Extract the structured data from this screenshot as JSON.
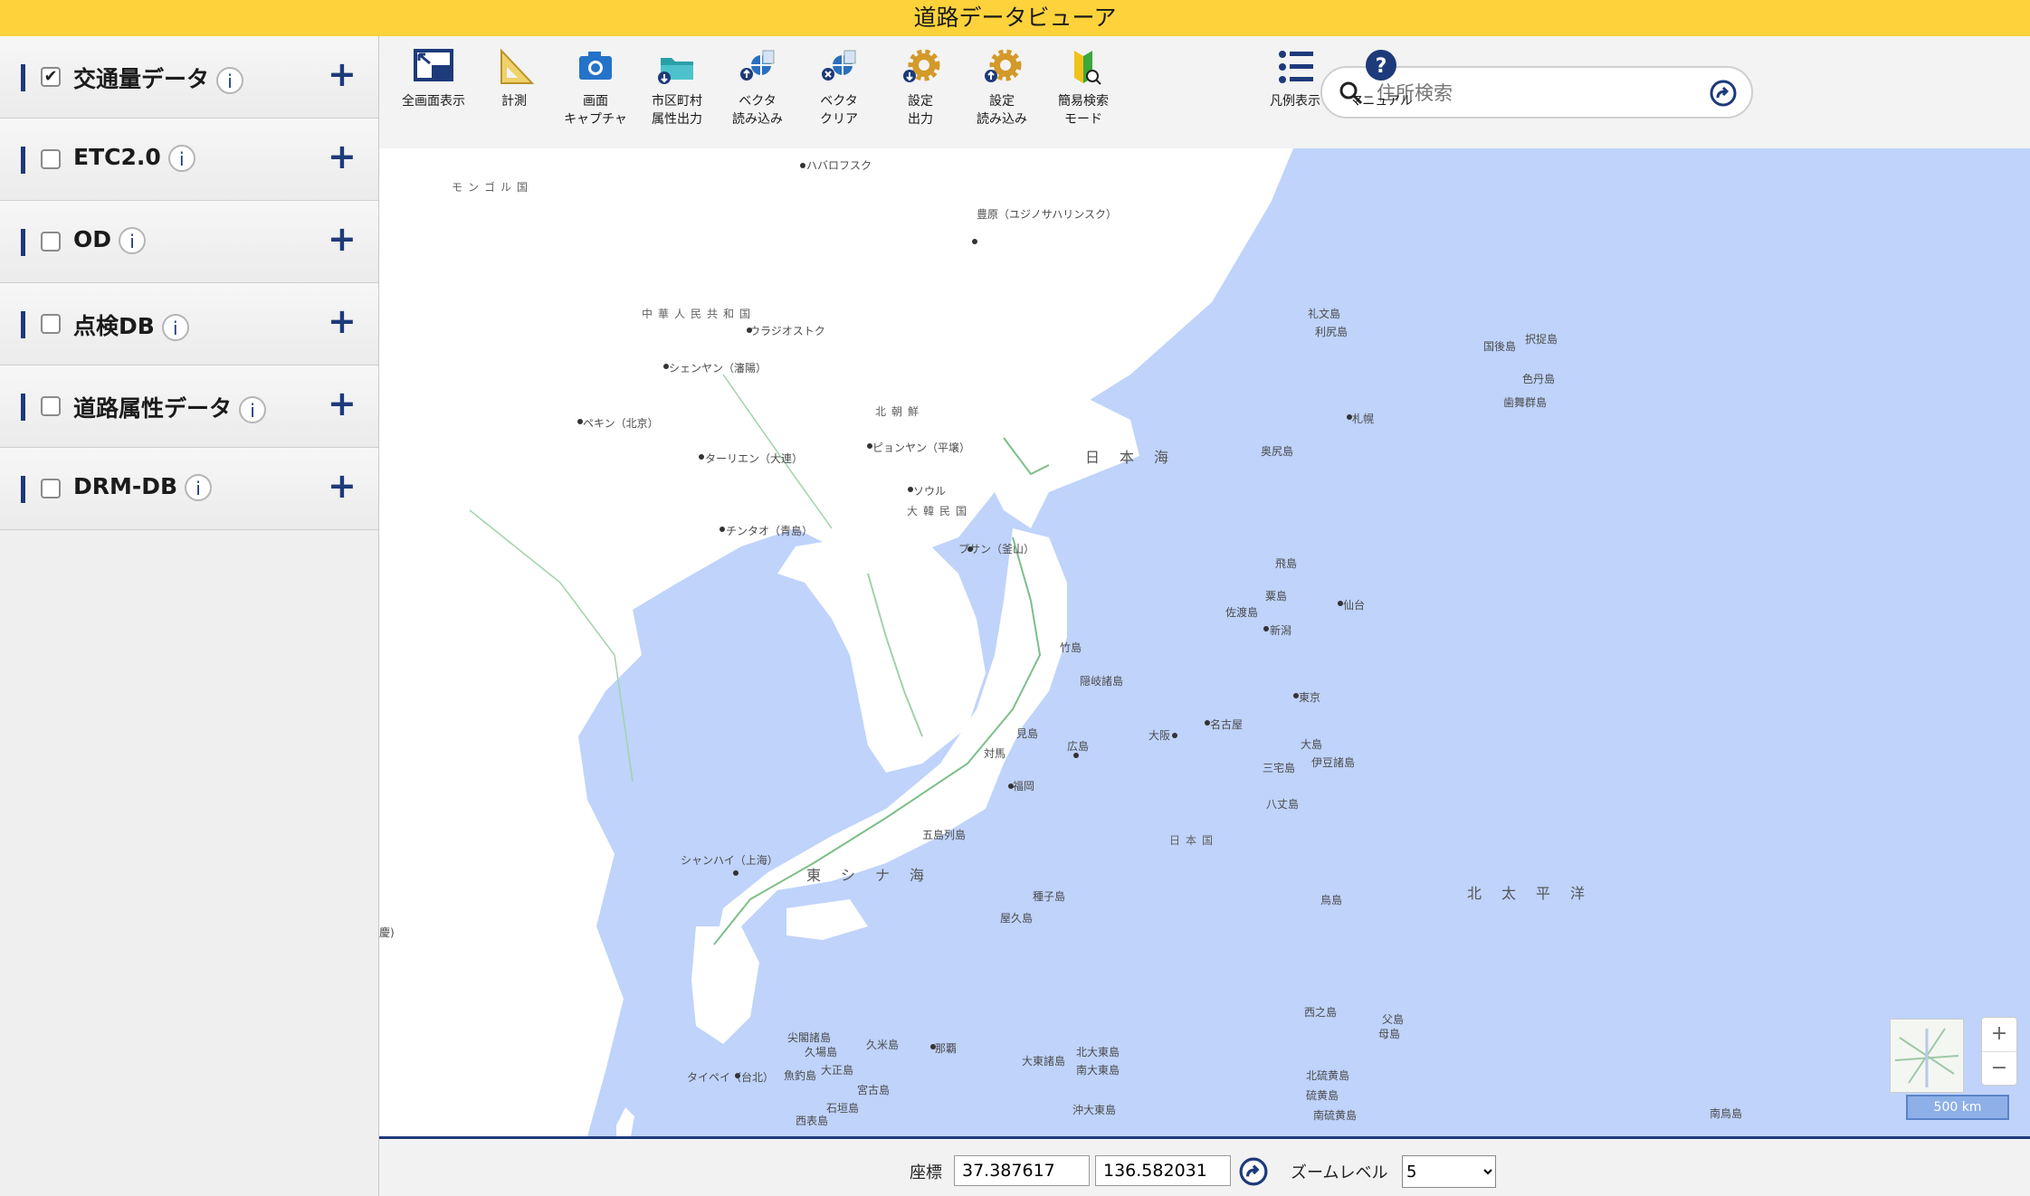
{
  "app": {
    "title": "道路データビューア"
  },
  "sidebar": {
    "layers": [
      {
        "label": "交通量データ",
        "checked": true,
        "info": "i",
        "expand": "+"
      },
      {
        "label": "ETC2.0",
        "checked": false,
        "info": "i",
        "expand": "+"
      },
      {
        "label": "OD",
        "checked": false,
        "info": "i",
        "expand": "+"
      },
      {
        "label": "点検DB",
        "checked": false,
        "info": "i",
        "expand": "+"
      },
      {
        "label": "道路属性データ",
        "checked": false,
        "info": "i",
        "expand": "+"
      },
      {
        "label": "DRM-DB",
        "checked": false,
        "info": "i",
        "expand": "+"
      }
    ]
  },
  "toolbar": {
    "tools": [
      {
        "line1": "全画面表示",
        "line2": "",
        "icon": "fullscreen-icon"
      },
      {
        "line1": "計測",
        "line2": "",
        "icon": "ruler-icon"
      },
      {
        "line1": "画面",
        "line2": "キャプチャ",
        "icon": "camera-icon"
      },
      {
        "line1": "市区町村",
        "line2": "属性出力",
        "icon": "folder-export-icon"
      },
      {
        "line1": "ベクタ",
        "line2": "読み込み",
        "icon": "vector-load-icon"
      },
      {
        "line1": "ベクタ",
        "line2": "クリア",
        "icon": "vector-clear-icon"
      },
      {
        "line1": "設定",
        "line2": "出力",
        "icon": "settings-export-icon"
      },
      {
        "line1": "設定",
        "line2": "読み込み",
        "icon": "settings-import-icon"
      },
      {
        "line1": "簡易検索",
        "line2": "モード",
        "icon": "beginner-search-icon"
      }
    ],
    "search": {
      "placeholder": "住所検索"
    },
    "legend_label": "凡例表示",
    "manual_label": "マニュアル"
  },
  "map": {
    "places": [
      {
        "text": "ハバロフスク",
        "cls": ""
      },
      {
        "text": "豊原（ユジノサハリンスク）",
        "cls": ""
      },
      {
        "text": "モンゴル国",
        "cls": "mid"
      },
      {
        "text": "中華人民共和国",
        "cls": "mid"
      },
      {
        "text": "ウラジオストク",
        "cls": ""
      },
      {
        "text": "シェンヤン（瀋陽）",
        "cls": ""
      },
      {
        "text": "北朝鮮",
        "cls": "mid"
      },
      {
        "text": "ペキン（北京）",
        "cls": ""
      },
      {
        "text": "ピョンヤン（平壌）",
        "cls": ""
      },
      {
        "text": "ターリエン（大連）",
        "cls": ""
      },
      {
        "text": "ソウル",
        "cls": ""
      },
      {
        "text": "大韓民国",
        "cls": "mid"
      },
      {
        "text": "チンタオ（青島）",
        "cls": ""
      },
      {
        "text": "プサン（釜山）",
        "cls": ""
      },
      {
        "text": "日本海",
        "cls": "big"
      },
      {
        "text": "札幌",
        "cls": ""
      },
      {
        "text": "仙台",
        "cls": ""
      },
      {
        "text": "新潟",
        "cls": ""
      },
      {
        "text": "東京",
        "cls": ""
      },
      {
        "text": "名古屋",
        "cls": ""
      },
      {
        "text": "大阪",
        "cls": ""
      },
      {
        "text": "広島",
        "cls": ""
      },
      {
        "text": "福岡",
        "cls": ""
      },
      {
        "text": "日本国",
        "cls": "mid"
      },
      {
        "text": "シャンハイ（上海）",
        "cls": ""
      },
      {
        "text": "東シナ海",
        "cls": "big"
      },
      {
        "text": "北太平洋",
        "cls": "big"
      },
      {
        "text": "那覇",
        "cls": ""
      },
      {
        "text": "タイペイ（台北）",
        "cls": ""
      },
      {
        "text": "竹島",
        "cls": ""
      },
      {
        "text": "隠岐諸島",
        "cls": ""
      },
      {
        "text": "佐渡島",
        "cls": ""
      },
      {
        "text": "粟島",
        "cls": ""
      },
      {
        "text": "飛島",
        "cls": ""
      },
      {
        "text": "奥尻島",
        "cls": ""
      },
      {
        "text": "礼文島",
        "cls": ""
      },
      {
        "text": "利尻島",
        "cls": ""
      },
      {
        "text": "国後島",
        "cls": ""
      },
      {
        "text": "択捉島",
        "cls": ""
      },
      {
        "text": "色丹島",
        "cls": ""
      },
      {
        "text": "歯舞群島",
        "cls": ""
      },
      {
        "text": "対馬",
        "cls": ""
      },
      {
        "text": "見島",
        "cls": ""
      },
      {
        "text": "三宅島",
        "cls": ""
      },
      {
        "text": "八丈島",
        "cls": ""
      },
      {
        "text": "大島",
        "cls": ""
      },
      {
        "text": "伊豆諸島",
        "cls": ""
      },
      {
        "text": "種子島",
        "cls": ""
      },
      {
        "text": "屋久島",
        "cls": ""
      },
      {
        "text": "五島列島",
        "cls": ""
      },
      {
        "text": "鳥島",
        "cls": ""
      },
      {
        "text": "西之島",
        "cls": ""
      },
      {
        "text": "父島",
        "cls": ""
      },
      {
        "text": "母島",
        "cls": ""
      },
      {
        "text": "北硫黄島",
        "cls": ""
      },
      {
        "text": "硫黄島",
        "cls": ""
      },
      {
        "text": "南硫黄島",
        "cls": ""
      },
      {
        "text": "尖閣諸島",
        "cls": ""
      },
      {
        "text": "久米島",
        "cls": ""
      },
      {
        "text": "久場島",
        "cls": ""
      },
      {
        "text": "大正島",
        "cls": ""
      },
      {
        "text": "宮古島",
        "cls": ""
      },
      {
        "text": "魚釣島",
        "cls": ""
      },
      {
        "text": "石垣島",
        "cls": ""
      },
      {
        "text": "西表島",
        "cls": ""
      },
      {
        "text": "北大東島",
        "cls": ""
      },
      {
        "text": "南大東島",
        "cls": ""
      },
      {
        "text": "沖大東島",
        "cls": ""
      },
      {
        "text": "大東諸島",
        "cls": ""
      },
      {
        "text": "南鳥島",
        "cls": ""
      },
      {
        "text": "慶)",
        "cls": ""
      }
    ],
    "scale_label": "500 km",
    "zoom_in": "+",
    "zoom_out": "−"
  },
  "footer": {
    "coord_label": "座標",
    "lat": "37.387617",
    "lon": "136.582031",
    "zoom_label": "ズームレベル",
    "zoom_value": "5"
  },
  "colors": {
    "accent": "#1d3a7a",
    "titlebar": "#fdd23a",
    "sea": "#bfd3fb"
  }
}
